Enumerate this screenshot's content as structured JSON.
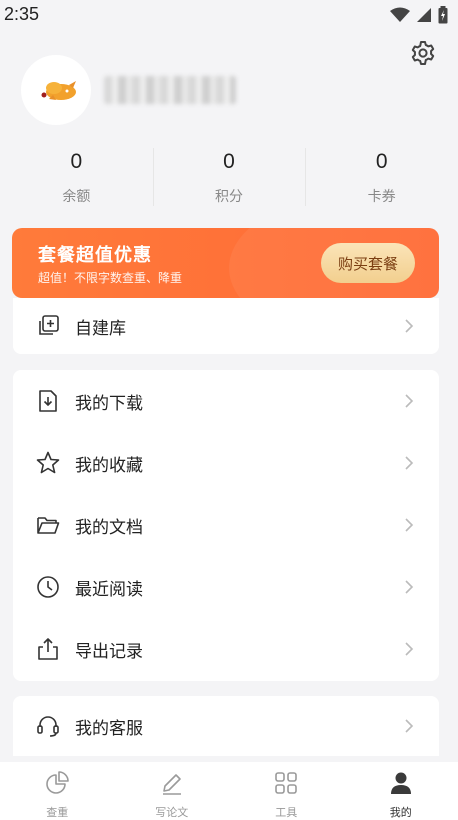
{
  "status": {
    "time": "2:35"
  },
  "stats": [
    {
      "value": "0",
      "label": "余额"
    },
    {
      "value": "0",
      "label": "积分"
    },
    {
      "value": "0",
      "label": "卡券"
    }
  ],
  "promo": {
    "title": "套餐超值优惠",
    "subtitle": "超值！不限字数查重、降重",
    "button": "购买套餐"
  },
  "menu": {
    "card1": [
      {
        "label": "自建库",
        "icon": "add-library-icon"
      }
    ],
    "card2": [
      {
        "label": "我的下载",
        "icon": "download-file-icon"
      },
      {
        "label": "我的收藏",
        "icon": "star-icon"
      },
      {
        "label": "我的文档",
        "icon": "folder-icon"
      },
      {
        "label": "最近阅读",
        "icon": "clock-icon"
      },
      {
        "label": "导出记录",
        "icon": "export-icon"
      }
    ],
    "card3": [
      {
        "label": "我的客服",
        "icon": "headset-icon"
      }
    ]
  },
  "bottom_nav": [
    {
      "label": "查重",
      "icon": "pie-chart-icon",
      "active": false
    },
    {
      "label": "写论文",
      "icon": "pen-icon",
      "active": false
    },
    {
      "label": "工具",
      "icon": "grid-icon",
      "active": false
    },
    {
      "label": "我的",
      "icon": "person-icon",
      "active": true
    }
  ],
  "colors": {
    "accent": "#ff7038",
    "promo_button": "#f2cf8e",
    "background": "#f4f4f6"
  }
}
